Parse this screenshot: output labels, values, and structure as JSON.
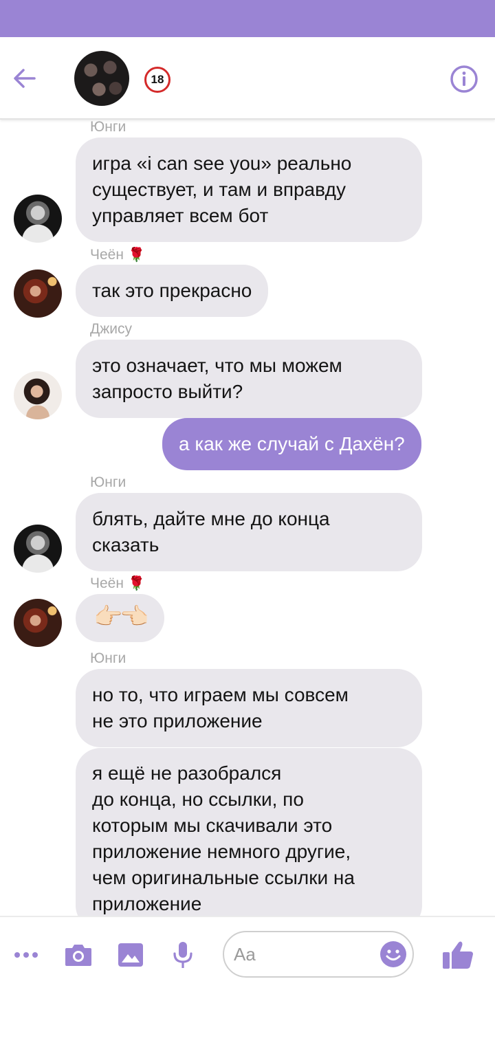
{
  "colors": {
    "accent": "#9a84d4",
    "bubble_in": "#e9e7ec",
    "sender": "#a8a8a8",
    "badge_ring": "#d42a2a"
  },
  "header": {
    "badge_text": "18",
    "icons": [
      "back-arrow-icon",
      "group-avatar",
      "info-icon"
    ]
  },
  "messages": [
    {
      "sender": "Юнги",
      "direction": "in",
      "lines": [
        "игра «i can see you» реально",
        "существует, и там и вправду",
        "управляет всем бот"
      ]
    },
    {
      "sender": "Чеён",
      "sender_emoji": "🌹",
      "direction": "in",
      "lines": [
        "так это прекрасно"
      ]
    },
    {
      "sender": "Джису",
      "direction": "in",
      "lines": [
        "это означает, что мы можем",
        "запросто выйти?"
      ]
    },
    {
      "direction": "out",
      "lines": [
        "а как же случай с Дахён?"
      ]
    },
    {
      "sender": "Юнги",
      "direction": "in",
      "lines": [
        "блять, дайте мне до конца",
        "сказать"
      ]
    },
    {
      "sender": "Чеён",
      "sender_emoji": "🌹",
      "direction": "in",
      "lines": [
        "👉🏻👈🏻"
      ]
    },
    {
      "sender": "Юнги",
      "direction": "in",
      "lines": [
        "но то, что играем мы совсем",
        "не это приложение"
      ]
    },
    {
      "direction": "in",
      "lines": [
        "я ещё не разобрался",
        "до конца, но ссылки, по",
        "которым мы скачивали это",
        "приложение немного другие,",
        "чем оригинальные ссылки на",
        "приложение"
      ]
    }
  ],
  "composer": {
    "placeholder": "Aa",
    "icons": [
      "more-icon",
      "camera-icon",
      "image-icon",
      "microphone-icon",
      "emoji-icon",
      "thumbs-up-icon"
    ]
  }
}
